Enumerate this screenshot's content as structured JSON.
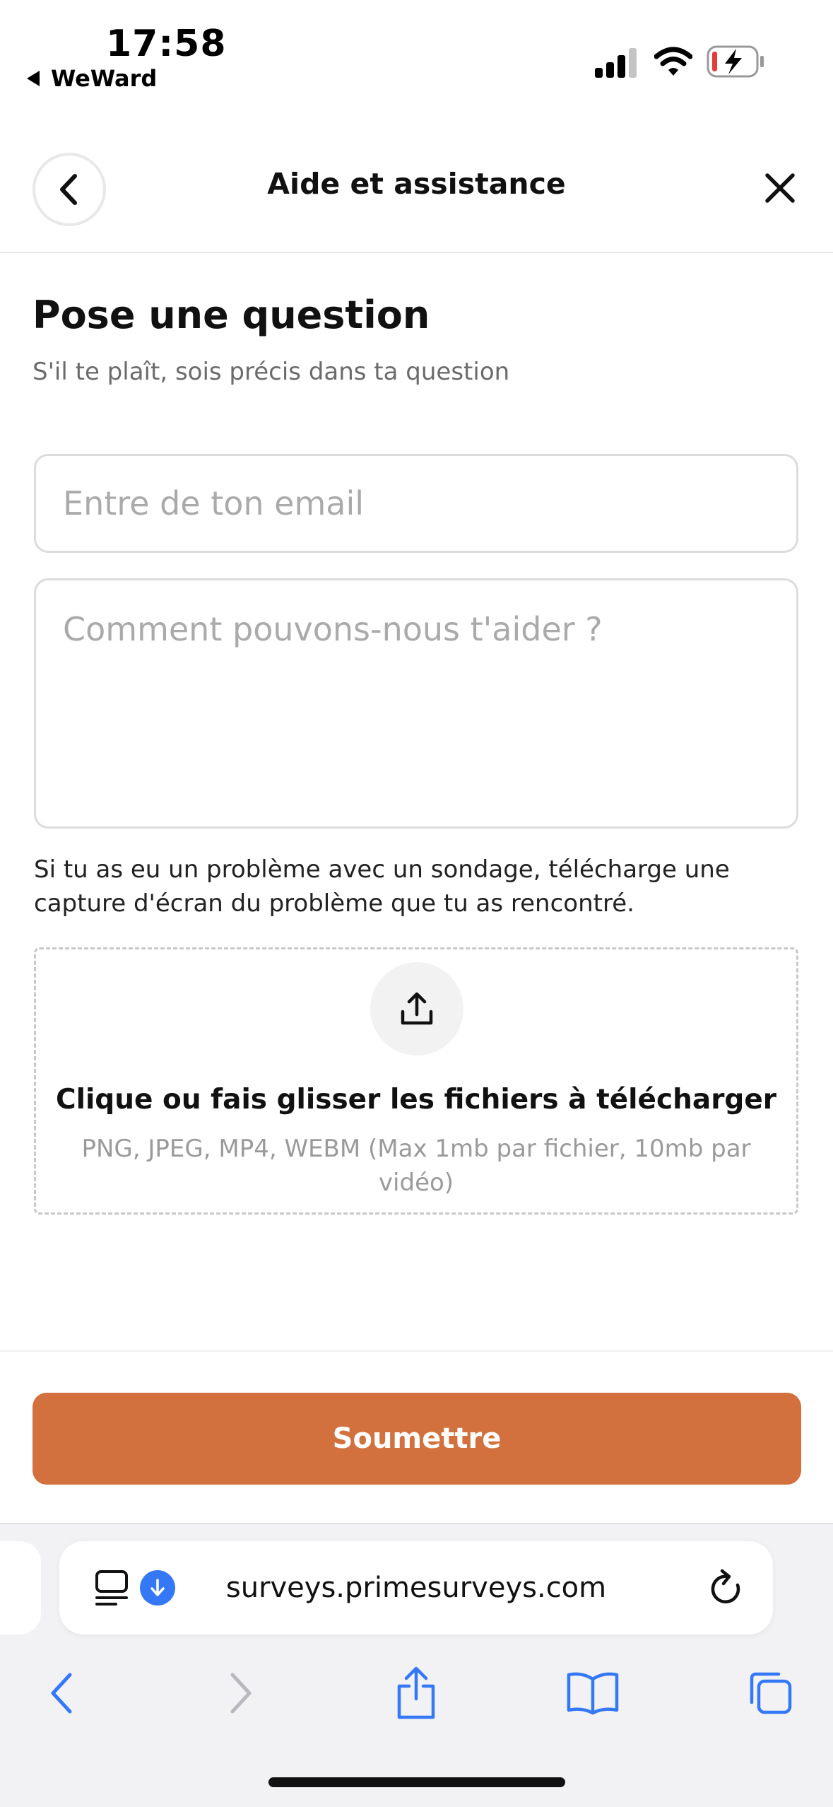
{
  "status_bar": {
    "time": "17:58",
    "back_app": "WeWard",
    "icons": [
      "cellular-signal-icon",
      "wifi-icon",
      "battery-charging-icon"
    ]
  },
  "header": {
    "title": "Aide et assistance",
    "back_icon": "chevron-left-icon",
    "close_icon": "close-icon"
  },
  "form": {
    "title": "Pose une question",
    "subtitle": "S'il te plaît, sois précis dans ta question",
    "email_placeholder": "Entre de ton email",
    "message_placeholder": "Comment pouvons-nous t'aider ?",
    "help_text": "Si tu as eu un problème avec un sondage, télécharge une capture d'écran du problème que tu as rencontré.",
    "upload": {
      "icon": "upload-icon",
      "title": "Clique ou fais glisser les fichiers à télécharger",
      "subtitle": "PNG, JPEG, MP4, WEBM (Max 1mb par fichier, 10mb par vidéo)"
    },
    "submit_label": "Soumettre"
  },
  "browser": {
    "url": "surveys.primesurveys.com",
    "icons": [
      "reader-mode-icon",
      "download-icon",
      "reload-icon",
      "back-arrow-icon",
      "forward-arrow-icon",
      "share-icon",
      "bookmarks-icon",
      "tabs-icon"
    ]
  },
  "colors": {
    "accent": "#d2713d",
    "browser_blue": "#3478f6",
    "placeholder": "#aaaaaa",
    "border": "#dcdcdc"
  }
}
